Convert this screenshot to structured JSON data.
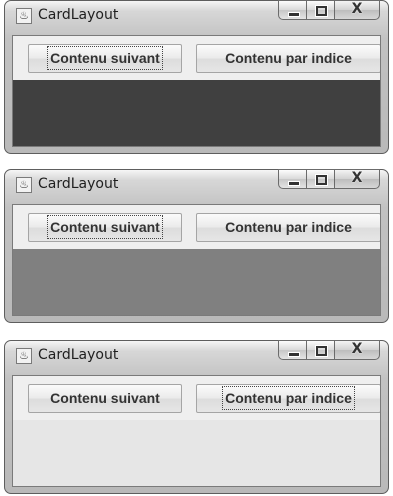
{
  "windows": [
    {
      "title": "CardLayout",
      "buttons": {
        "next_label": "Contenu suivant",
        "index_label": "Contenu par indice"
      },
      "focused": "next",
      "card_color": "#404040"
    },
    {
      "title": "CardLayout",
      "buttons": {
        "next_label": "Contenu suivant",
        "index_label": "Contenu par indice"
      },
      "focused": "next",
      "card_color": "#808080"
    },
    {
      "title": "CardLayout",
      "buttons": {
        "next_label": "Contenu suivant",
        "index_label": "Contenu par indice"
      },
      "focused": "index",
      "card_color": "#e6e6e6"
    }
  ],
  "icons": {
    "app": "java-cup-icon",
    "minimize": "minimize-icon",
    "maximize": "maximize-icon",
    "close": "close-icon"
  }
}
